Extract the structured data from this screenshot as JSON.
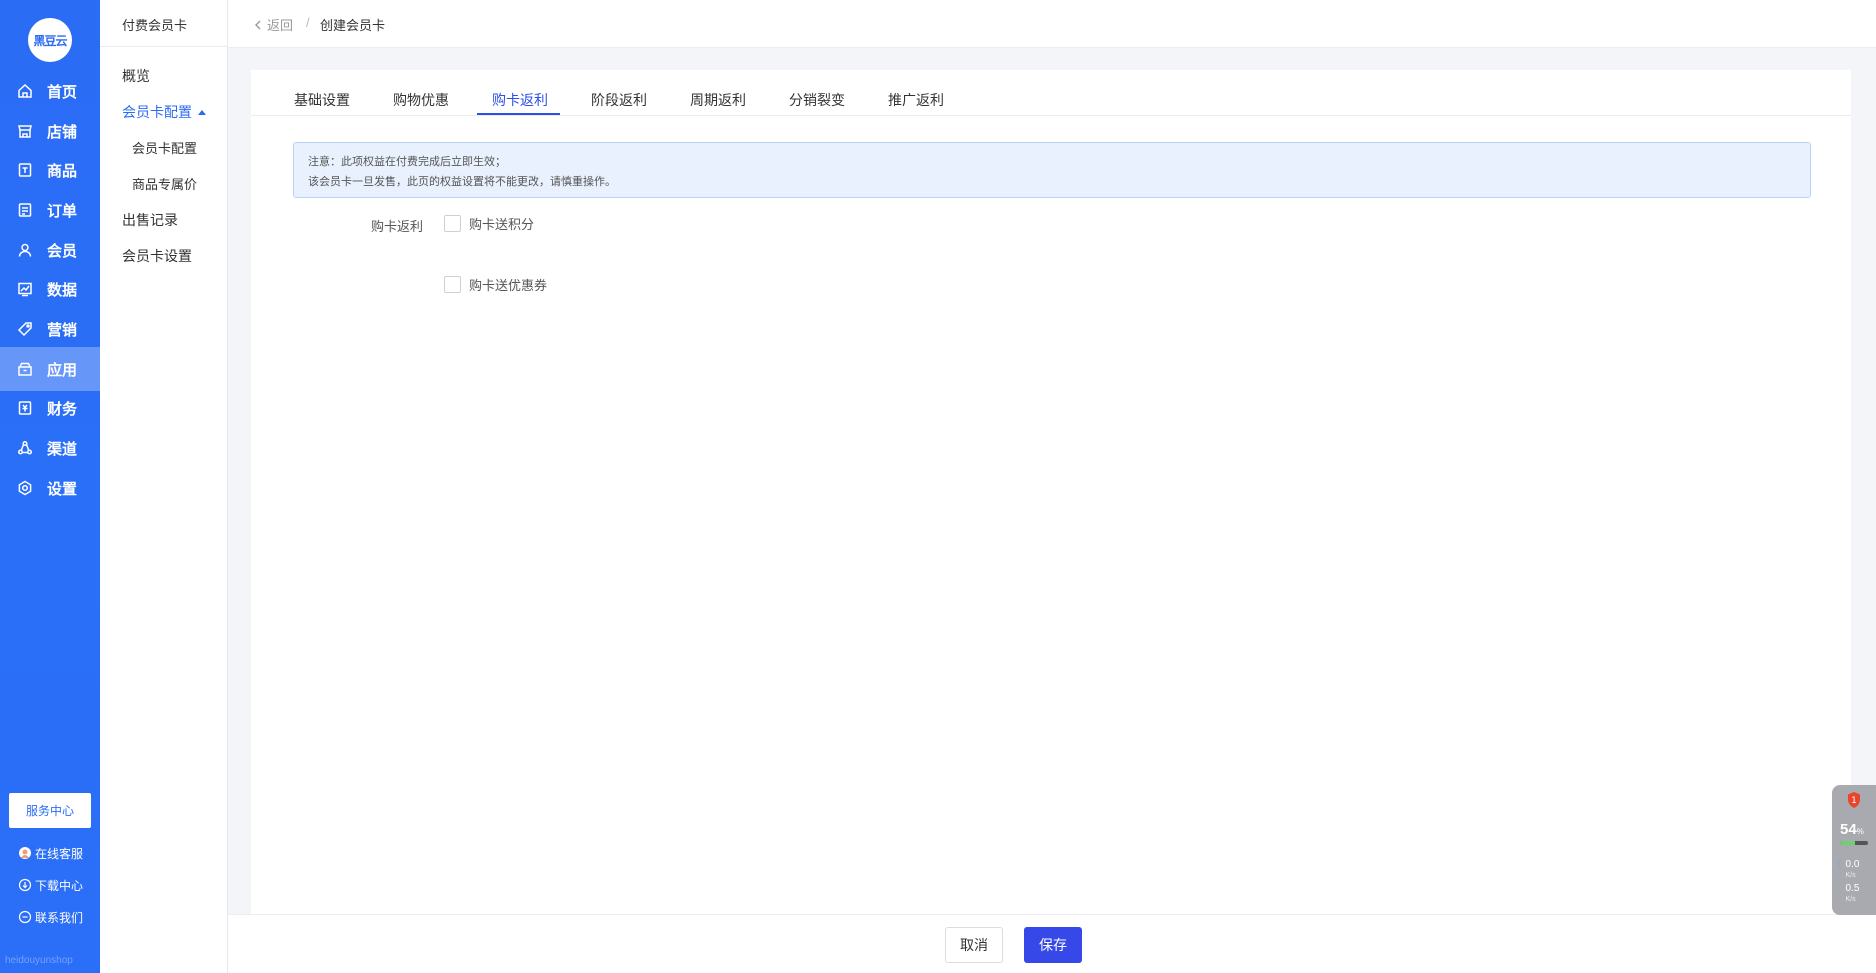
{
  "logo": {
    "text": "黑豆云"
  },
  "nav": {
    "items": [
      {
        "label": "首页",
        "icon": "home-icon"
      },
      {
        "label": "店铺",
        "icon": "shop-icon"
      },
      {
        "label": "商品",
        "icon": "goods-icon"
      },
      {
        "label": "订单",
        "icon": "order-icon"
      },
      {
        "label": "会员",
        "icon": "member-icon"
      },
      {
        "label": "数据",
        "icon": "data-icon"
      },
      {
        "label": "营销",
        "icon": "tag-icon"
      },
      {
        "label": "应用",
        "icon": "app-icon",
        "active": true
      },
      {
        "label": "财务",
        "icon": "finance-icon"
      },
      {
        "label": "渠道",
        "icon": "channel-icon"
      },
      {
        "label": "设置",
        "icon": "settings-icon"
      }
    ],
    "service_center": "服务中心",
    "online_service": "在线客服",
    "download_center": "下载中心",
    "contact_us": "联系我们",
    "brand_footer": "heidouyunshop"
  },
  "subnav": {
    "title": "付费会员卡",
    "items": {
      "overview": "概览",
      "card_config": "会员卡配置",
      "card_config_child": "会员卡配置",
      "exclusive_price": "商品专属价",
      "sales_record": "出售记录",
      "card_settings": "会员卡设置"
    }
  },
  "header": {
    "back": "返回",
    "separator": "/",
    "current": "创建会员卡"
  },
  "tabs": [
    "基础设置",
    "购物优惠",
    "购卡返利",
    "阶段返利",
    "周期返利",
    "分销裂变",
    "推广返利"
  ],
  "active_tab": "购卡返利",
  "notice": {
    "line1": "注意：此项权益在付费完成后立即生效；",
    "line2": "该会员卡一旦发售，此页的权益设置将不能更改，请慎重操作。"
  },
  "form": {
    "label": "购卡返利",
    "option_points": "购卡送积分",
    "option_coupon": "购卡送优惠券"
  },
  "footer": {
    "cancel": "取消",
    "save": "保存"
  },
  "monitor": {
    "badge": "1",
    "percent": "54",
    "percent_unit": "%",
    "upload": "0.0",
    "download": "0.5",
    "speed_unit": "K/s"
  },
  "colors": {
    "nav_bg": "#2b6cf5",
    "primary": "#3648e8",
    "tab_active": "#2b50e8",
    "notice_bg": "#e8f1fd"
  }
}
